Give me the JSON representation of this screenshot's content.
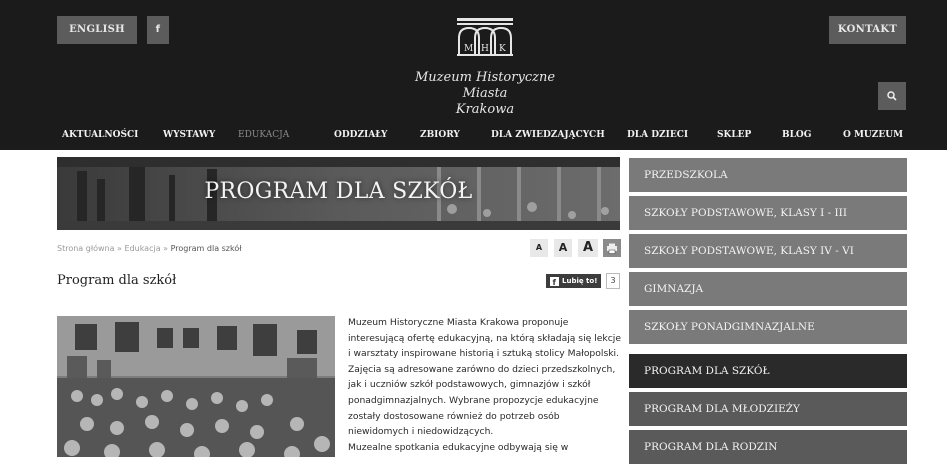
{
  "header": {
    "english_label": "ENGLISH",
    "facebook_label": "f",
    "contact_label": "KONTAKT",
    "logo_letters": [
      "M",
      "H",
      "K"
    ],
    "museum_name_line1": "Muzeum Historyczne Miasta",
    "museum_name_line2": "Krakowa"
  },
  "nav": {
    "items": [
      {
        "label": "AKTUALNOŚCI"
      },
      {
        "label": "WYSTAWY"
      },
      {
        "label": "EDUKACJA"
      },
      {
        "label": "ODDZIAŁY"
      },
      {
        "label": "ZBIORY"
      },
      {
        "label": "DLA ZWIEDZAJĄCYCH"
      },
      {
        "label": "DLA DZIECI"
      },
      {
        "label": "SKLEP"
      },
      {
        "label": "BLOG"
      },
      {
        "label": "O MUZEUM"
      }
    ]
  },
  "banner": {
    "title": "PROGRAM DLA SZKÓŁ"
  },
  "breadcrumb": {
    "home": "Strona główna",
    "sep": " » ",
    "section": "Edukacja",
    "current": "Program dla szkół"
  },
  "font_tools": {
    "small": "A",
    "medium": "A",
    "large": "A"
  },
  "page": {
    "title": "Program dla szkół"
  },
  "facebook": {
    "like_label": "Lubię to!",
    "count": "3"
  },
  "content": {
    "lines": [
      "Muzeum Historyczne Miasta Krakowa proponuje",
      "interesującą ofertę edukacyjną, na którą składają się lekcje",
      "i warsztaty inspirowane historią i sztuką stolicy Małopolski.",
      "Zajęcia są adresowane zarówno do dzieci przedszkolnych,",
      "jak i uczniów szkół podstawowych, gimnazjów i szkół",
      "ponadgimnazjalnych. Wybrane propozycje edukacyjne",
      "zostały dostosowane również do potrzeb osób",
      "niewidomych i niedowidzących.",
      "Muzealne spotkania edukacyjne odbywają się w"
    ]
  },
  "sidebar": {
    "items": [
      {
        "label": "PRZEDSZKOLA"
      },
      {
        "label": "SZKOŁY PODSTAWOWE, KLASY I - III"
      },
      {
        "label": "SZKOŁY PODSTAWOWE, KLASY IV - VI"
      },
      {
        "label": "GIMNAZJA"
      },
      {
        "label": "SZKOŁY PONADGIMNAZJALNE"
      },
      {
        "label": "PROGRAM DLA SZKÓŁ"
      },
      {
        "label": "PROGRAM DLA MŁODZIEŻY"
      },
      {
        "label": "PROGRAM DLA RODZIN"
      }
    ]
  },
  "colors": {
    "header_bg": "#1b1b1b",
    "button_bg": "#5c5c5c",
    "sidebar_light": "#7a7a7a",
    "sidebar_dark": "#5a5a5a",
    "sidebar_active": "#2a2a2a"
  },
  "icons": {
    "search": "search-icon",
    "facebook": "facebook-icon",
    "print": "print-icon",
    "logo": "mhk-logo"
  }
}
